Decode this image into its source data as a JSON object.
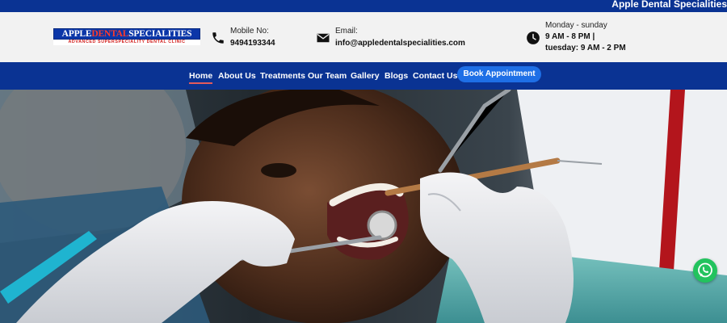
{
  "topbar": {
    "text": "Apple Dental Specialities"
  },
  "logo": {
    "main_prefix": "APPLE",
    "main_accent": "DENTAL",
    "main_suffix": "SPECIALITIES",
    "tagline": "ADVANCED SUPERSPECIALITY DENTAL CLINIC"
  },
  "contacts": {
    "phone": {
      "label": "Mobile No:",
      "value": "9494193344",
      "icon": "phone-icon"
    },
    "email": {
      "label": "Email:",
      "value": "info@appledentalspecialities.com",
      "icon": "envelope-icon"
    },
    "hours": {
      "label": "Monday - sunday",
      "line1": "9 AM - 8 PM |",
      "line2": "tuesday: 9 AM - 2 PM",
      "icon": "clock-icon"
    }
  },
  "nav": {
    "items": [
      {
        "label": "Home",
        "active": true
      },
      {
        "label": "About Us"
      },
      {
        "label": "Treatments"
      },
      {
        "label": "Our Team"
      },
      {
        "label": "Gallery"
      },
      {
        "label": "Blogs"
      },
      {
        "label": "Contact Us"
      }
    ],
    "cta": "Book Appointment"
  },
  "hero": {
    "icon": "dental-patient-photo"
  },
  "floating": {
    "icon": "whatsapp-icon"
  },
  "colors": {
    "brand_blue": "#0a3393",
    "cta_blue": "#1e6fe6",
    "accent_red": "#e35b5b",
    "whatsapp_green": "#22c35e"
  }
}
